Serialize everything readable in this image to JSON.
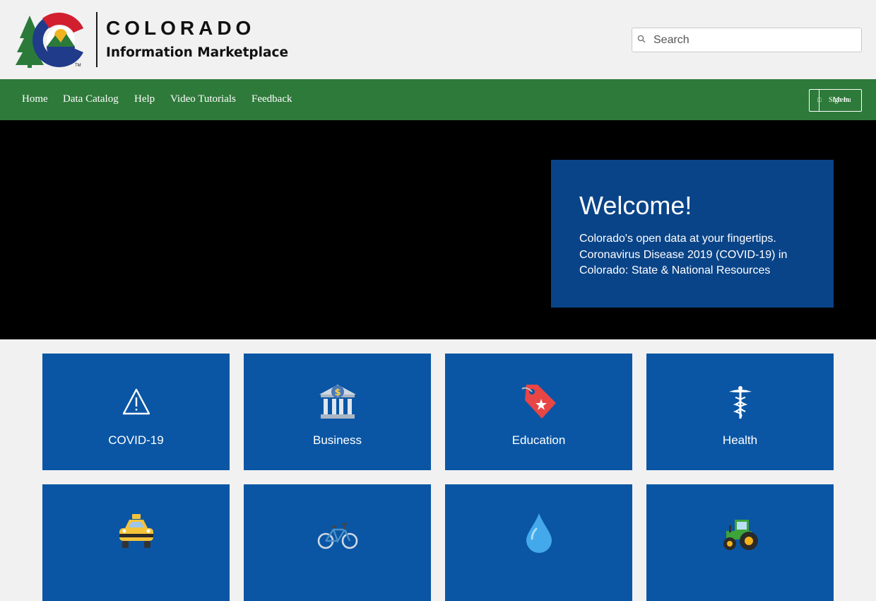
{
  "logo": {
    "title": "COLORADO",
    "subtitle": "Information Marketplace"
  },
  "search": {
    "placeholder": "Search",
    "value": ""
  },
  "nav": {
    "items": [
      {
        "label": "Home"
      },
      {
        "label": "Data Catalog"
      },
      {
        "label": "Help"
      },
      {
        "label": "Video Tutorials"
      },
      {
        "label": "Feedback"
      }
    ],
    "signin_label": "Sign In",
    "menu_label": "Menu"
  },
  "welcome": {
    "title": "Welcome!",
    "text": "Colorado's open data at your fingertips. Coronavirus Disease 2019 (COVID-19) in Colorado: State & National Resources"
  },
  "categories": [
    {
      "label": "COVID-19",
      "icon": "warning-icon"
    },
    {
      "label": "Business",
      "icon": "bank-icon"
    },
    {
      "label": "Education",
      "icon": "bookmark-tag-icon"
    },
    {
      "label": "Health",
      "icon": "caduceus-icon"
    },
    {
      "label": "",
      "icon": "taxi-icon"
    },
    {
      "label": "",
      "icon": "bicycle-icon"
    },
    {
      "label": "",
      "icon": "water-drop-icon"
    },
    {
      "label": "",
      "icon": "tractor-icon"
    }
  ],
  "colors": {
    "nav_green": "#2e7a3a",
    "welcome_blue": "#0a4488",
    "tile_blue": "#0a56a5",
    "logo_navy": "#1f3b8a",
    "logo_red": "#d11f2f",
    "logo_gold": "#f1b322",
    "logo_green": "#2b7a3a"
  }
}
